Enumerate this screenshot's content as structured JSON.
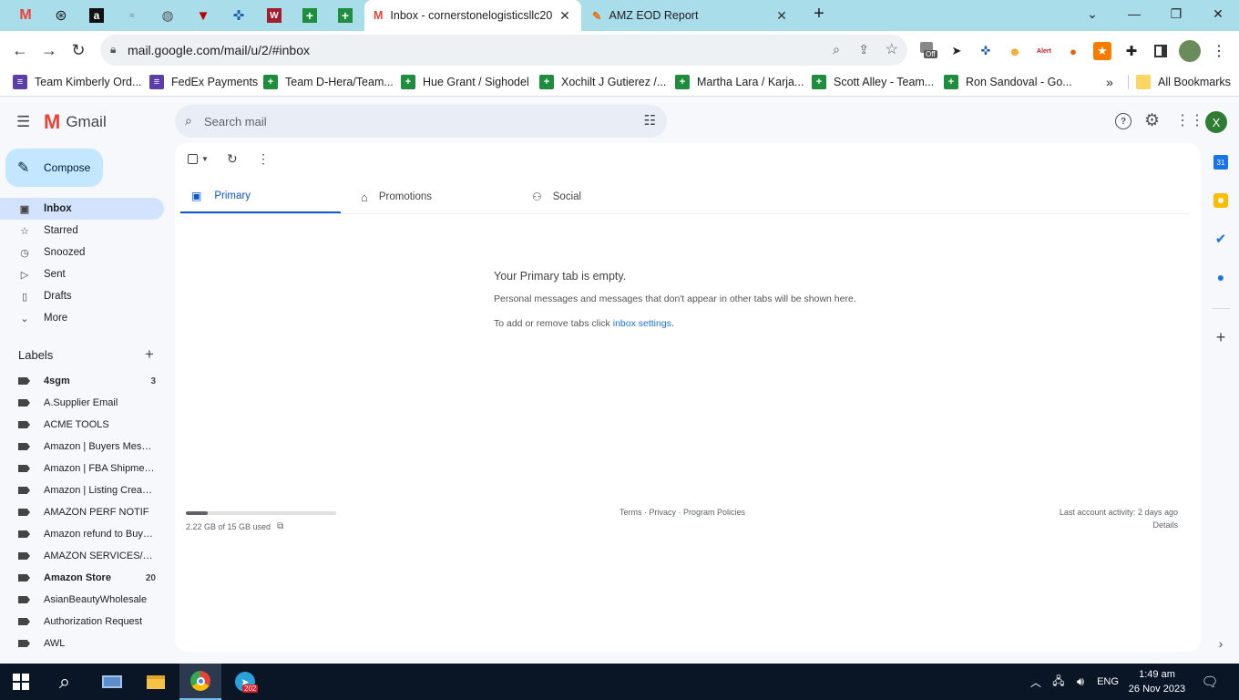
{
  "browser": {
    "tabs": [
      {
        "title": "Inbox - cornerstonelogisticsllc20",
        "active": true
      },
      {
        "title": "AMZ EOD Report",
        "active": false
      }
    ],
    "url": "mail.google.com/mail/u/2/#inbox",
    "ext_off_label": "Off",
    "ext_alert_label": "Alert",
    "bookmarks": [
      "Team Kimberly Ord...",
      "FedEx Payments",
      "Team D-Hera/Team...",
      "Hue Grant / Sighodel",
      "Xochilt J Gutierez /...",
      "Martha Lara / Karja...",
      "Scott Alley - Team...",
      "Ron Sandoval - Go..."
    ],
    "all_bookmarks": "All Bookmarks"
  },
  "gmail": {
    "brand": "Gmail",
    "search_placeholder": "Search mail",
    "avatar_letter": "X",
    "compose_label": "Compose",
    "nav": [
      {
        "label": "Inbox",
        "icon": "inbox-icon",
        "active": true
      },
      {
        "label": "Starred",
        "icon": "star-icon"
      },
      {
        "label": "Snoozed",
        "icon": "clock-icon"
      },
      {
        "label": "Sent",
        "icon": "send-icon"
      },
      {
        "label": "Drafts",
        "icon": "draft-icon"
      },
      {
        "label": "More",
        "icon": "chevron-down-icon"
      }
    ],
    "labels_heading": "Labels",
    "labels": [
      {
        "name": "4sgm",
        "count": "3",
        "bold": true
      },
      {
        "name": "A.Supplier Email",
        "count": ""
      },
      {
        "name": "ACME TOOLS",
        "count": ""
      },
      {
        "name": "Amazon | Buyers Messa...",
        "count": ""
      },
      {
        "name": "Amazon | FBA Shipments",
        "count": ""
      },
      {
        "name": "Amazon | Listing Created",
        "count": ""
      },
      {
        "name": "AMAZON PERF NOTIF",
        "count": ""
      },
      {
        "name": "Amazon refund to Buyers",
        "count": ""
      },
      {
        "name": "AMAZON SERVICES/PAY...",
        "count": ""
      },
      {
        "name": "Amazon Store",
        "count": "20",
        "bold": true
      },
      {
        "name": "AsianBeautyWholesale",
        "count": ""
      },
      {
        "name": "Authorization Request",
        "count": ""
      },
      {
        "name": "AWL",
        "count": ""
      }
    ],
    "tabs": [
      "Primary",
      "Promotions",
      "Social"
    ],
    "empty": {
      "title": "Your Primary tab is empty.",
      "line1": "Personal messages and messages that don't appear in other tabs will be shown here.",
      "line2_prefix": "To add or remove tabs click ",
      "line2_link": "inbox settings",
      "line2_suffix": "."
    },
    "footer": {
      "storage": "2.22 GB of 15 GB used",
      "storage_fraction": 0.148,
      "terms": "Terms",
      "privacy": "Privacy",
      "policies": "Program Policies",
      "sep": " · ",
      "activity": "Last account activity: 2 days ago",
      "details": "Details"
    }
  },
  "taskbar": {
    "badge": "202",
    "lang": "ENG",
    "time": "1:49 am",
    "date": "26 Nov 2023"
  },
  "colors": {
    "tabstrip": "#a8dde9",
    "accent": "#0b57d0",
    "compose": "#c2e7ff"
  }
}
